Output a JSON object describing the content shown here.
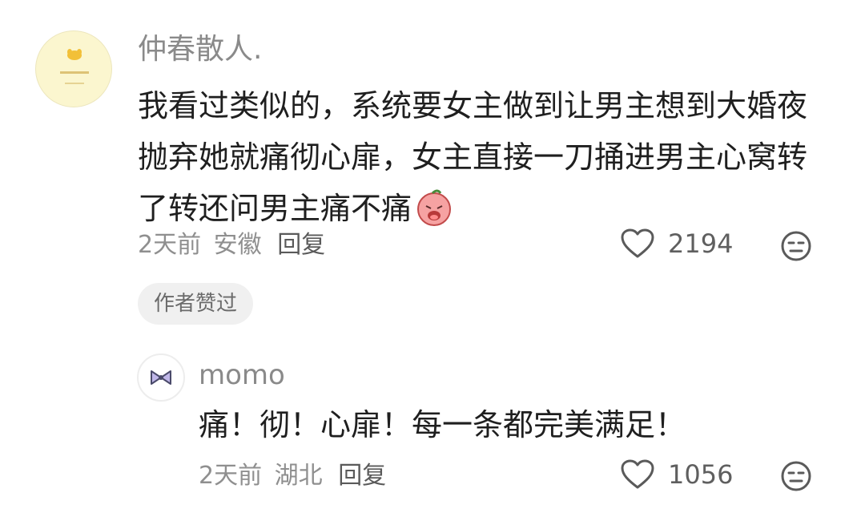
{
  "comment": {
    "username": "仲春散人.",
    "text": "我看过类似的，系统要女主做到让男主想到大婚夜抛弃她就痛彻心扉，女主直接一刀捅进男主心窝转了转还问男主痛不痛",
    "emoji": "crying-face-emoji",
    "time": "2天前",
    "location": "安徽",
    "reply_label": "回复",
    "likes": "2194",
    "author_liked_badge": "作者赞过"
  },
  "reply": {
    "username": "momo",
    "text": "痛！彻！心扉！每一条都完美满足！",
    "time": "2天前",
    "location": "湖北",
    "reply_label": "回复",
    "likes": "1056"
  },
  "colors": {
    "muted": "#8a8a8a",
    "body": "#1f1f1f",
    "badge_bg": "#f0f0f0"
  }
}
